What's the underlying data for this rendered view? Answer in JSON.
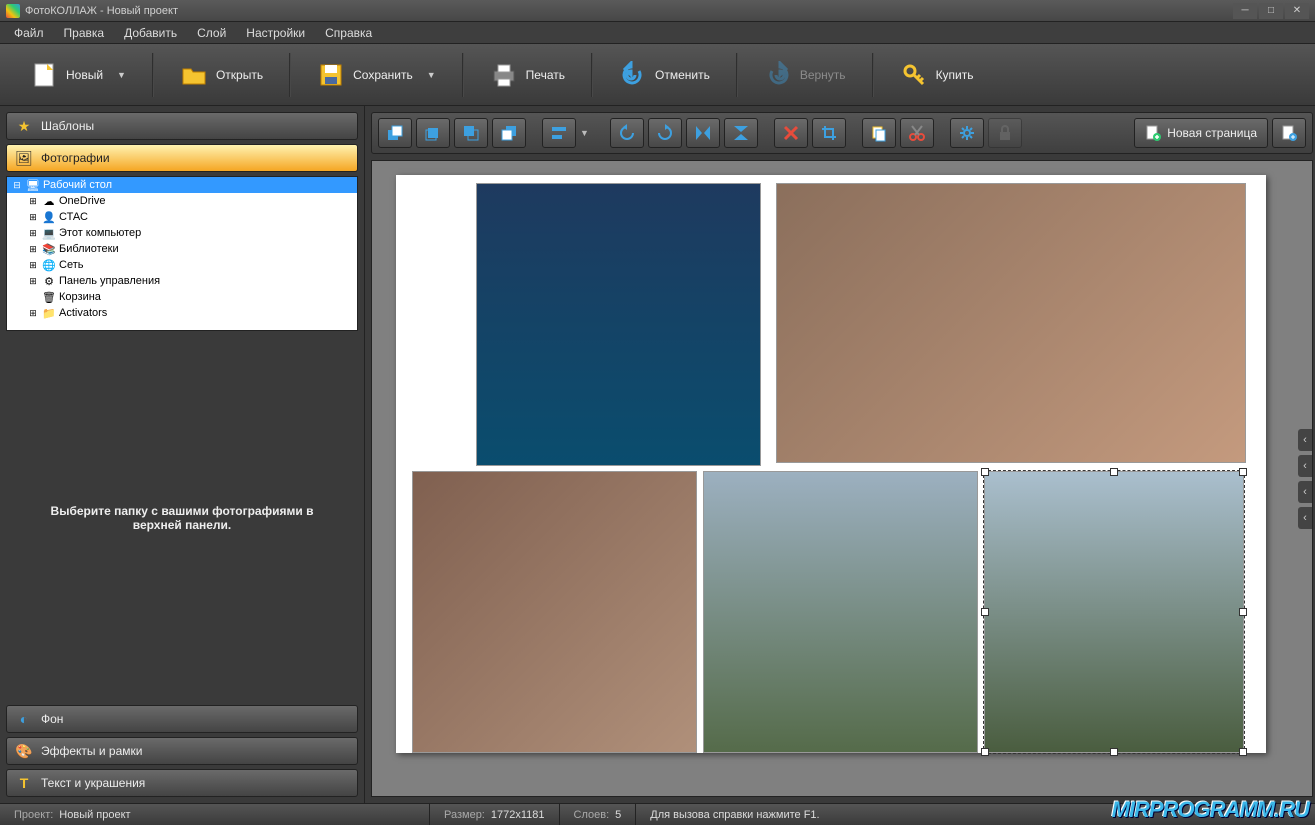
{
  "title": "ФотоКОЛЛАЖ - Новый проект",
  "menu": {
    "file": "Файл",
    "edit": "Правка",
    "add": "Добавить",
    "layer": "Слой",
    "settings": "Настройки",
    "help": "Справка"
  },
  "toolbar": {
    "new": "Новый",
    "open": "Открыть",
    "save": "Сохранить",
    "print": "Печать",
    "undo": "Отменить",
    "redo": "Вернуть",
    "buy": "Купить"
  },
  "sidebar": {
    "templates": "Шаблоны",
    "photos": "Фотографии",
    "background": "Фон",
    "effects": "Эффекты и рамки",
    "text": "Текст и украшения",
    "hint": "Выберите папку с вашими фотографиями в верхней панели."
  },
  "tree": [
    {
      "indent": 0,
      "exp": "⊟",
      "icon": "🖥",
      "label": "Рабочий стол",
      "sel": true
    },
    {
      "indent": 1,
      "exp": "⊞",
      "icon": "☁",
      "label": "OneDrive"
    },
    {
      "indent": 1,
      "exp": "⊞",
      "icon": "👤",
      "label": "СТАС"
    },
    {
      "indent": 1,
      "exp": "⊞",
      "icon": "💻",
      "label": "Этот компьютер"
    },
    {
      "indent": 1,
      "exp": "⊞",
      "icon": "📚",
      "label": "Библиотеки"
    },
    {
      "indent": 1,
      "exp": "⊞",
      "icon": "🌐",
      "label": "Сеть"
    },
    {
      "indent": 1,
      "exp": "⊞",
      "icon": "⚙",
      "label": "Панель управления"
    },
    {
      "indent": 1,
      "exp": " ",
      "icon": "🗑",
      "label": "Корзина"
    },
    {
      "indent": 1,
      "exp": "⊞",
      "icon": "📁",
      "label": "Activators"
    }
  ],
  "edit_toolbar": {
    "new_page": "Новая страница"
  },
  "status": {
    "project_label": "Проект:",
    "project": "Новый проект",
    "size_label": "Размер:",
    "size": "1772x1181",
    "layers_label": "Слоев:",
    "layers": "5",
    "help": "Для вызова справки нажмите F1."
  },
  "watermark": "MIRPROGRAMM.RU"
}
